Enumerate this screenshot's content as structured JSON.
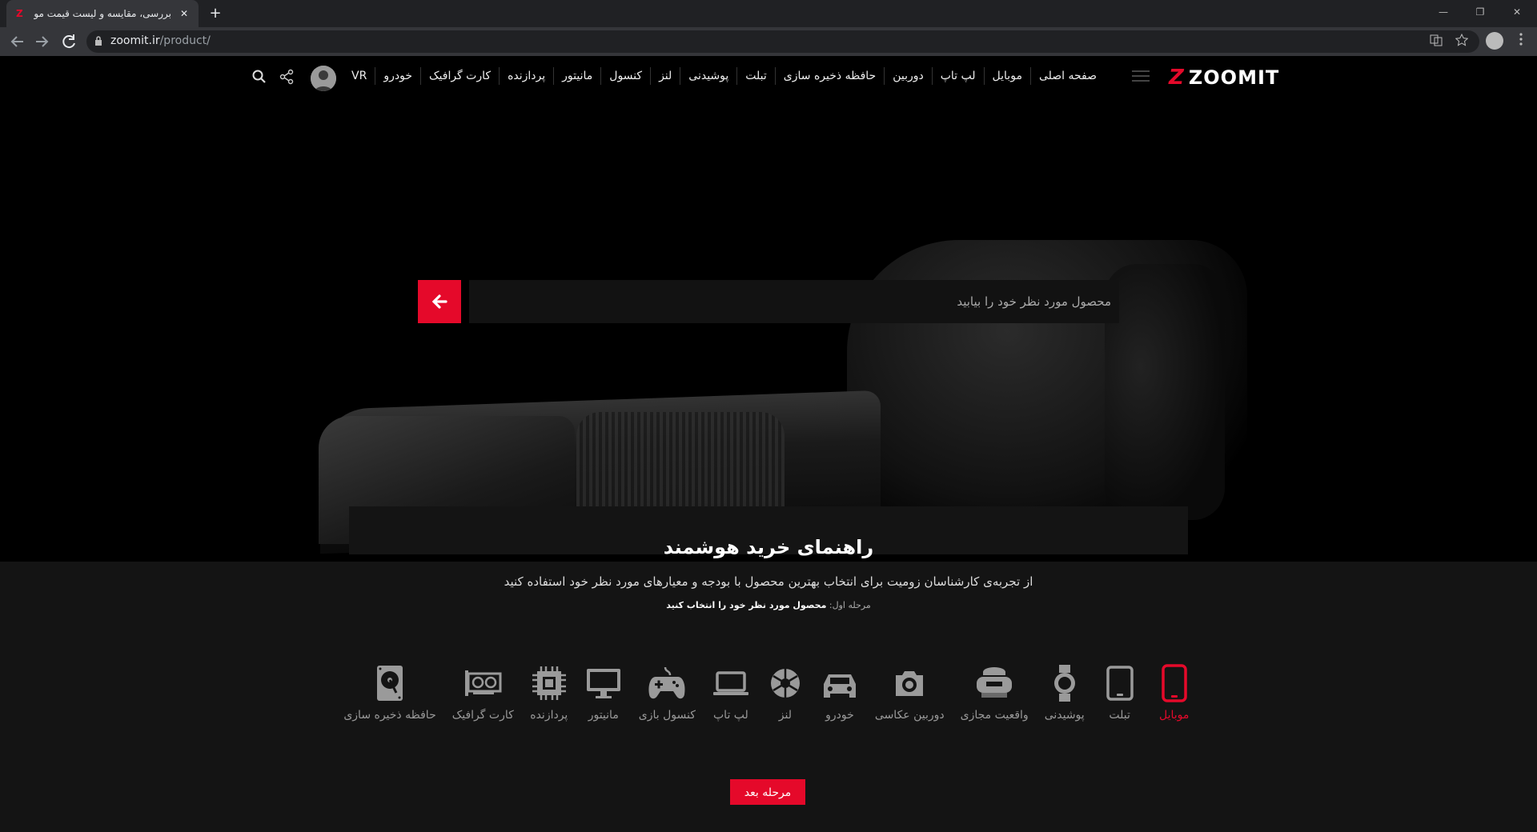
{
  "browser": {
    "tab_title": "بررسی، مقایسه و لیست قیمت موبایل",
    "tab_close": "✕",
    "new_tab": "+",
    "url_host": "zoomit.ir",
    "url_path": "/product/",
    "window_controls": [
      "—",
      "❐",
      "✕"
    ]
  },
  "site": {
    "logo_mark": "Z",
    "logo_text": "ZOOMIT",
    "nav": [
      "صفحه اصلی",
      "موبایل",
      "لپ تاپ",
      "دوربین",
      "حافظه ذخیره سازی",
      "تبلت",
      "پوشیدنی",
      "لنز",
      "کنسول",
      "مانیتور",
      "پردازنده",
      "کارت گرافیک",
      "خودرو",
      "VR"
    ]
  },
  "hero": {
    "search_placeholder": "محصول مورد نظر خود را بیابید"
  },
  "guide": {
    "title": "راهنمای خرید هوشمند",
    "subtitle": "از تجربه‌ی کارشناسان زومیت برای انتخاب بهترین محصول با بودجه و معیارهای مورد نظر خود استفاده کنید",
    "step_prefix": "مرحله اول:",
    "step_text": "محصول مورد نظر خود را انتخاب کنید",
    "categories": [
      {
        "label": "موبایل",
        "icon": "mobile-icon",
        "active": true
      },
      {
        "label": "تبلت",
        "icon": "tablet-icon",
        "active": false
      },
      {
        "label": "پوشیدنی",
        "icon": "watch-icon",
        "active": false
      },
      {
        "label": "واقعیت مجازی",
        "icon": "vr-headset-icon",
        "active": false
      },
      {
        "label": "دوربین عکاسی",
        "icon": "camera-icon",
        "active": false
      },
      {
        "label": "خودرو",
        "icon": "car-icon",
        "active": false
      },
      {
        "label": "لنز",
        "icon": "aperture-icon",
        "active": false
      },
      {
        "label": "لپ تاپ",
        "icon": "laptop-icon",
        "active": false
      },
      {
        "label": "کنسول بازی",
        "icon": "gamepad-icon",
        "active": false
      },
      {
        "label": "مانیتور",
        "icon": "monitor-icon",
        "active": false
      },
      {
        "label": "پردازنده",
        "icon": "cpu-icon",
        "active": false
      },
      {
        "label": "کارت گرافیک",
        "icon": "gpu-icon",
        "active": false
      },
      {
        "label": "حافظه ذخیره سازی",
        "icon": "hard-drive-icon",
        "active": false
      }
    ],
    "next_label": "مرحله بعد"
  },
  "colors": {
    "accent": "#e5092a",
    "icon_gray": "#9a9a9a"
  }
}
